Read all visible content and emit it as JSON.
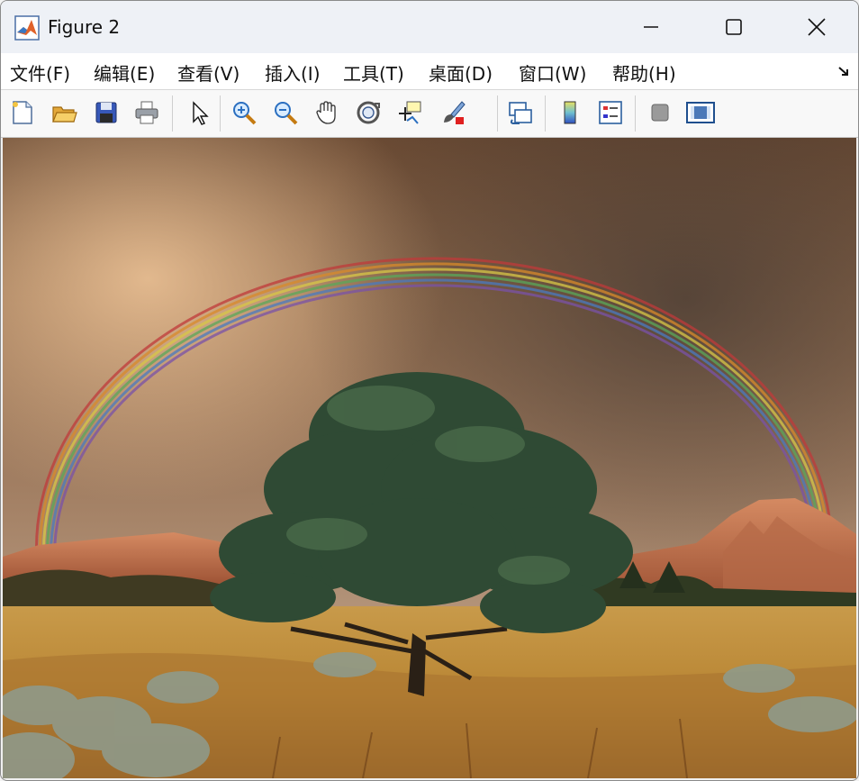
{
  "window": {
    "title": "Figure 2"
  },
  "menu": {
    "items": [
      {
        "label": "文件(F)"
      },
      {
        "label": "编辑(E)"
      },
      {
        "label": "查看(V)"
      },
      {
        "label": "插入(I)"
      },
      {
        "label": "工具(T)"
      },
      {
        "label": "桌面(D)"
      },
      {
        "label": "窗口(W)"
      },
      {
        "label": "帮助(H)"
      }
    ]
  },
  "toolbar": {
    "icons": [
      "new-figure-icon",
      "open-file-icon",
      "save-icon",
      "print-icon",
      "pointer-icon",
      "zoom-in-icon",
      "zoom-out-icon",
      "pan-hand-icon",
      "rotate-3d-icon",
      "data-cursor-icon",
      "brush-icon",
      "link-plot-icon",
      "colorbar-icon",
      "legend-icon",
      "hide-plot-tools-icon",
      "show-plot-tools-icon"
    ]
  },
  "colors": {
    "titlebar": "#eef1f6",
    "menubar": "#ffffff",
    "toolbar": "#f8f8f8",
    "accent_blue": "#1a73c9"
  }
}
